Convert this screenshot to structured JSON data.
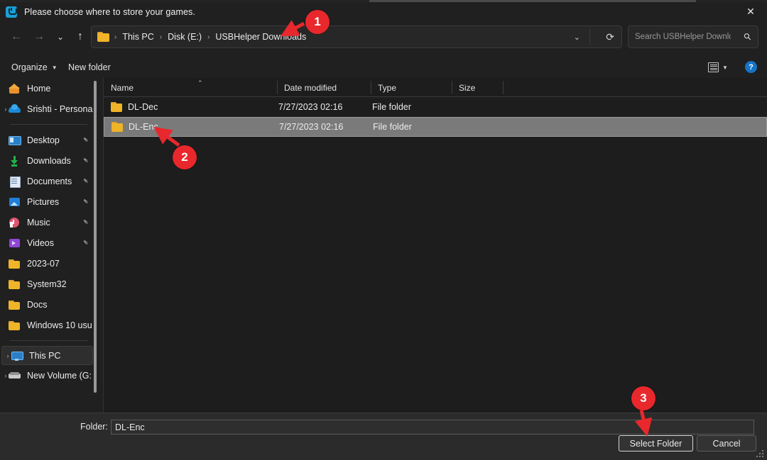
{
  "window": {
    "title": "Please choose where to store your games.",
    "app_icon": "usbhelper-logo-icon",
    "close_label": "✕"
  },
  "nav": {
    "back": "←",
    "forward": "→",
    "recent": "⌄",
    "up": "↑",
    "refresh": "⟳",
    "dropdown": "⌄"
  },
  "address": {
    "folder_icon": "folder-icon",
    "separator": "›",
    "crumbs": [
      {
        "label": "This PC"
      },
      {
        "label": "Disk (E:)"
      },
      {
        "label": "USBHelper Downloads"
      }
    ]
  },
  "search": {
    "placeholder": "Search USBHelper Downloa...",
    "value": "",
    "icon": "search-icon"
  },
  "commandbar": {
    "organize_label": "Organize",
    "organize_caret": "▼",
    "new_folder_label": "New folder",
    "view_caret": "▼",
    "help_label": "?"
  },
  "sidebar": {
    "items": [
      {
        "label": "Home",
        "icon": "home-icon",
        "expander": "",
        "pin": false,
        "selected": false
      },
      {
        "label": "Srishti - Persona",
        "icon": "onedrive-cloud-icon",
        "expander": "›",
        "pin": false,
        "selected": false
      },
      {
        "separator": true
      },
      {
        "label": "Desktop",
        "icon": "desktop-icon",
        "expander": "",
        "pin": true,
        "selected": false
      },
      {
        "label": "Downloads",
        "icon": "downloads-icon",
        "expander": "",
        "pin": true,
        "selected": false
      },
      {
        "label": "Documents",
        "icon": "documents-icon",
        "expander": "",
        "pin": true,
        "selected": false
      },
      {
        "label": "Pictures",
        "icon": "pictures-icon",
        "expander": "",
        "pin": true,
        "selected": false
      },
      {
        "label": "Music",
        "icon": "music-icon",
        "expander": "",
        "pin": true,
        "selected": false
      },
      {
        "label": "Videos",
        "icon": "videos-icon",
        "expander": "",
        "pin": true,
        "selected": false
      },
      {
        "label": "2023-07",
        "icon": "folder-icon",
        "expander": "",
        "pin": false,
        "selected": false
      },
      {
        "label": "System32",
        "icon": "folder-icon",
        "expander": "",
        "pin": false,
        "selected": false
      },
      {
        "label": "Docs",
        "icon": "folder-icon",
        "expander": "",
        "pin": false,
        "selected": false
      },
      {
        "label": "Windows 10 usu",
        "icon": "folder-icon",
        "expander": "",
        "pin": false,
        "selected": false
      },
      {
        "separator": true
      },
      {
        "label": "This PC",
        "icon": "this-pc-icon",
        "expander": "›",
        "pin": false,
        "selected": true
      },
      {
        "label": "New Volume (G:",
        "icon": "drive-icon",
        "expander": "›",
        "pin": false,
        "selected": false
      }
    ],
    "pin_glyph": "📌"
  },
  "filelist": {
    "columns": [
      "Name",
      "Date modified",
      "Type",
      "Size"
    ],
    "sort_indicator": "⌃",
    "rows": [
      {
        "name": "DL-Dec",
        "date": "7/27/2023 02:16",
        "type": "File folder",
        "size": "",
        "icon": "folder-icon",
        "selected": false
      },
      {
        "name": "DL-Enc",
        "date": "7/27/2023 02:16",
        "type": "File folder",
        "size": "",
        "icon": "folder-icon",
        "selected": true
      }
    ]
  },
  "footer": {
    "folder_label": "Folder:",
    "folder_value": "DL-Enc",
    "select_button": "Select Folder",
    "cancel_button": "Cancel"
  },
  "annotations": [
    {
      "number": "1",
      "target": "address-bar"
    },
    {
      "number": "2",
      "target": "dl-enc-row"
    },
    {
      "number": "3",
      "target": "select-folder-button"
    }
  ],
  "colors": {
    "annotation_red": "#e8282c",
    "folder_yellow": "#f0b429",
    "selection_gray": "#7a7a7a",
    "accent_blue": "#1673c6"
  }
}
